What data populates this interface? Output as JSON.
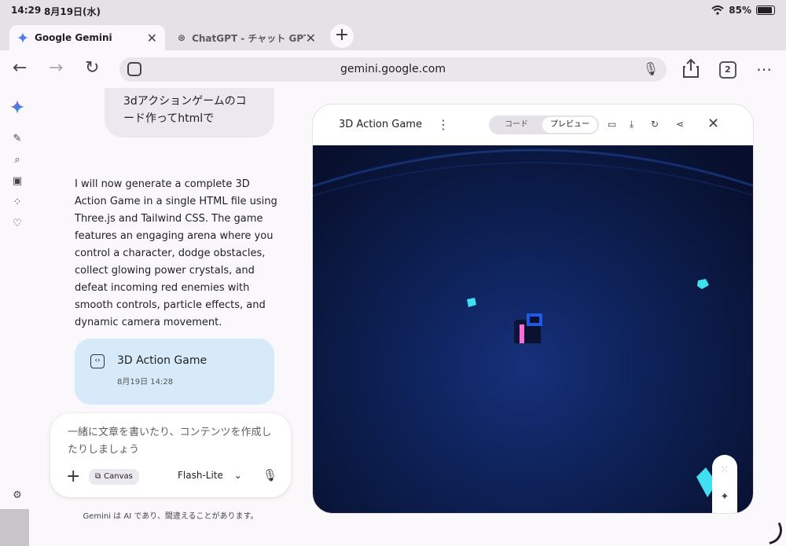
{
  "status": {
    "time": "14:29",
    "date": "8月19日(水)",
    "battery": "85%",
    "battery_level": 0.85
  },
  "tabs": [
    {
      "title": "Google Gemini",
      "active": true
    },
    {
      "title": "ChatGPT - チャット GPT",
      "active": false
    }
  ],
  "toolbar": {
    "url": "gemini.google.com",
    "tab_count": "2"
  },
  "chat": {
    "user_message": "3dアクションゲームのコード作ってhtmlで",
    "response": "I will now generate a complete 3D Action Game in a single HTML file using Three.js and Tailwind CSS. The game features an engaging arena where you control a character, dodge obstacles, collect glowing power crystals, and defeat incoming red enemies with smooth controls, particle effects, and dynamic camera movement.",
    "artifact": {
      "title": "3D Action Game",
      "date": "8月19日 14:28"
    }
  },
  "composer": {
    "placeholder": "一緒に文章を書いたり、コンテンツを作成したりしましょう",
    "canvas_chip": "Canvas",
    "model": "Flash-Lite"
  },
  "disclaimer": "Gemini は AI であり、間違えることがあります。",
  "panel": {
    "title": "3D Action Game",
    "seg_code": "コード",
    "seg_preview": "プレビュー"
  },
  "colors": {
    "game_bg": "#0b1a45",
    "crystal": "#3fe0f0",
    "player_accent": "#ff6ad5",
    "player_visor": "#1e5ae8"
  }
}
